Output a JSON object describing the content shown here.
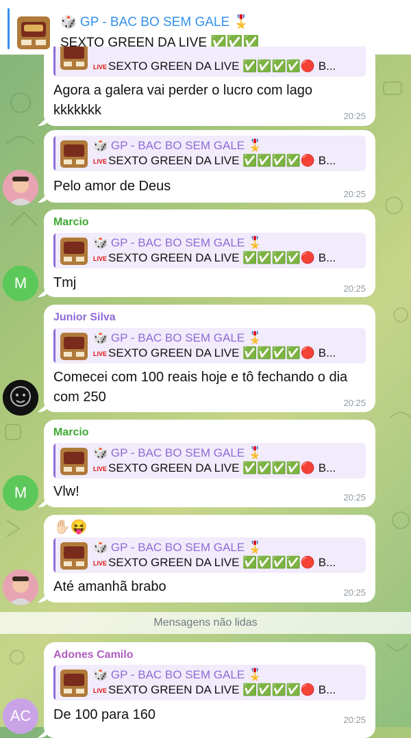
{
  "pinned": {
    "title": "🎲 GP - BAC BO SEM GALE 🎖️",
    "subtitle": "SEXTO GREEN DA LIVE ✅✅✅"
  },
  "reply_preview": {
    "title": "🎲 GP - BAC BO SEM GALE 🎖️",
    "live": "LIVE",
    "text": "SEXTO GREEN DA LIVE ✅✅✅✅🔴 B..."
  },
  "messages": [
    {
      "sender": "",
      "text": "Agora a galera vai perder o lucro com lago kkkkkkk",
      "time": "20:25"
    },
    {
      "sender": "",
      "text": "Pelo amor de Deus",
      "time": "20:25"
    },
    {
      "sender": "Marcio",
      "text": "Tmj",
      "time": "20:25",
      "avatar": "M"
    },
    {
      "sender": "Junior Silva",
      "text": "Comecei com 100 reais hoje e tô fechando o dia com 250",
      "time": "20:25"
    },
    {
      "sender": "Marcio",
      "text": "Vlw!",
      "time": "20:25",
      "avatar": "M"
    },
    {
      "sender": "",
      "emoji": "✋🏻😝",
      "text": "Até amanhã brabo",
      "time": "20:25"
    },
    {
      "sender": "Adones Camilo",
      "text": "De 100 para 160",
      "time": "20:25",
      "avatar": "AC"
    }
  ],
  "divider": "Mensagens não lidas",
  "colors": {
    "marcio": "#3ba82e",
    "junior": "#8e6bd6",
    "adones": "#b05cc0",
    "accent": "#3390ec"
  }
}
